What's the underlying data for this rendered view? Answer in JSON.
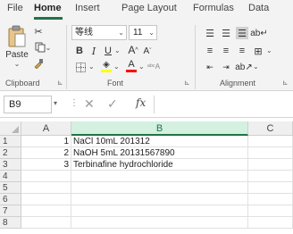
{
  "menu": {
    "tabs": [
      {
        "label": "File"
      },
      {
        "label": "Home"
      },
      {
        "label": "Insert"
      },
      {
        "label": "Page Layout"
      },
      {
        "label": "Formulas"
      },
      {
        "label": "Data"
      }
    ],
    "active": "Home"
  },
  "ribbon": {
    "clipboard": {
      "paste_label": "Paste",
      "group_label": "Clipboard"
    },
    "font": {
      "font_name": "等线",
      "font_size": "11",
      "group_label": "Font"
    },
    "alignment": {
      "group_label": "Alignment"
    }
  },
  "formula_bar": {
    "name_box": "B9",
    "fx_label": "fx",
    "value": ""
  },
  "grid": {
    "columns": [
      "A",
      "B",
      "C"
    ],
    "selected_column": "B",
    "rows": [
      {
        "num": "1",
        "a": "1",
        "b": "NaCl 10mL 201312"
      },
      {
        "num": "2",
        "a": "2",
        "b": "NaOH 5mL 20131567890"
      },
      {
        "num": "3",
        "a": "3",
        "b": "Terbinafine hydrochloride"
      },
      {
        "num": "4",
        "a": "",
        "b": ""
      },
      {
        "num": "5",
        "a": "",
        "b": ""
      },
      {
        "num": "6",
        "a": "",
        "b": ""
      },
      {
        "num": "7",
        "a": "",
        "b": ""
      },
      {
        "num": "8",
        "a": "",
        "b": ""
      }
    ]
  },
  "colors": {
    "accent": "#217346",
    "ribbon_bg": "#f3f3f3",
    "font_color_bar": "#ff0000",
    "highlight_bar": "#ffff00"
  }
}
